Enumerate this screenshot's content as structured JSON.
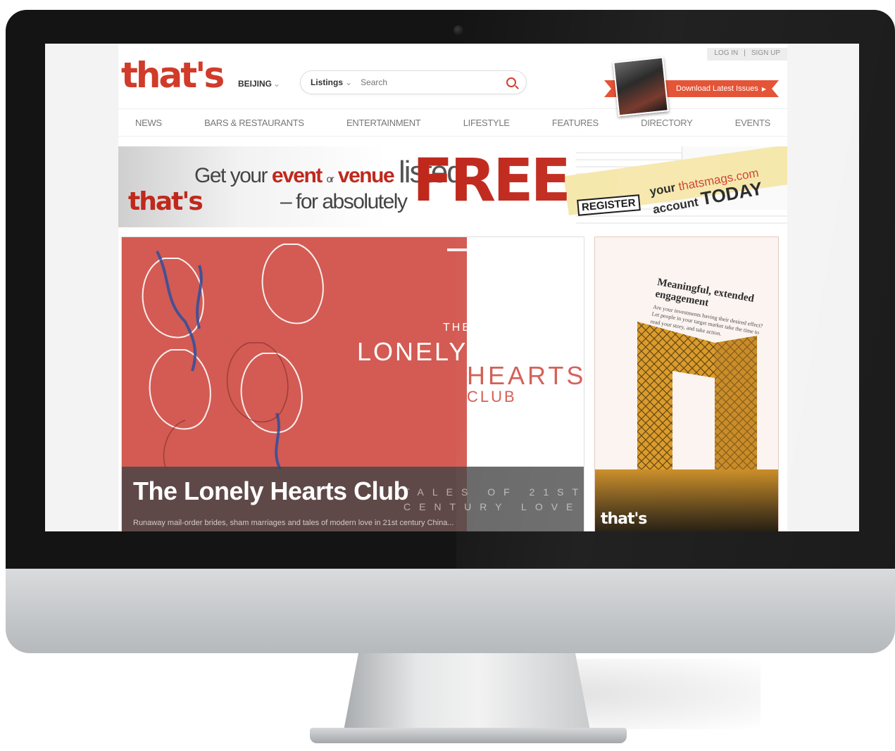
{
  "auth": {
    "login": "LOG IN",
    "sep": "|",
    "signup": "SIGN UP"
  },
  "brand": {
    "logo": "that's",
    "accent": "#d03b2a"
  },
  "city": {
    "label": "BEIJING",
    "chev": "⌄"
  },
  "search": {
    "category": "Listings",
    "chev": "⌄",
    "placeholder": "Search"
  },
  "download": {
    "label": "Download Latest Issues",
    "arrow": "▶"
  },
  "nav": [
    "NEWS",
    "BARS & RESTAURANTS",
    "ENTERTAINMENT",
    "LIFESTYLE",
    "FEATURES",
    "DIRECTORY",
    "EVENTS"
  ],
  "banner": {
    "logo": "that's",
    "get_your": "Get your",
    "event": "event",
    "or": "or",
    "venue": "venue",
    "listed": "listed",
    "for_absolutely": "– for absolutely",
    "free": "FREE",
    "register": "REGISTER",
    "your": "your",
    "site": "thatsmags.com",
    "account": "account",
    "today": "TODAY"
  },
  "hero": {
    "the": "THE",
    "lonely": "LONELY",
    "hearts": "HEARTS",
    "club": "CLUB",
    "headline": "The Lonely Hearts Club",
    "tales_1": "TALES OF 21ST",
    "tales_2": "CENTURY LOVE",
    "summary": "Runaway mail-order brides, sham marriages and tales of modern love in 21st century China..."
  },
  "ad": {
    "heading": "Meaningful, extended engagement",
    "body": "Are your investments having their desired effect? Let people in your target market take the time to read your story, and take action.",
    "logo": "that's"
  }
}
